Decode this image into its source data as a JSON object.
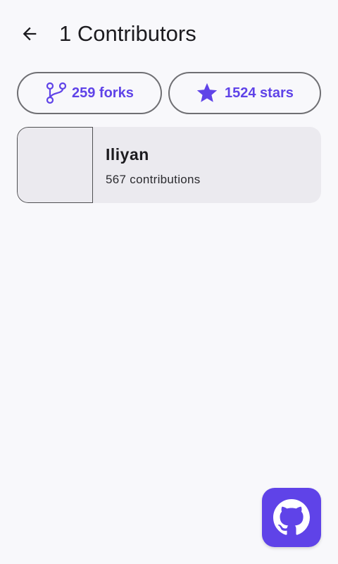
{
  "header": {
    "title": "1 Contributors",
    "back_icon": "arrow-back-icon"
  },
  "stats": {
    "forks_label": "259 forks",
    "stars_label": "1524 stars",
    "forks_icon": "fork-icon",
    "stars_icon": "star-icon"
  },
  "contributors": [
    {
      "name": "Iliyan",
      "contributions": "567 contributions"
    }
  ],
  "fab": {
    "icon": "github-icon"
  },
  "colors": {
    "accent": "#5f43e8",
    "background": "#f8f8fb",
    "card": "#ebeaef",
    "text": "#1c1b1f",
    "outline": "#6f6f73"
  }
}
